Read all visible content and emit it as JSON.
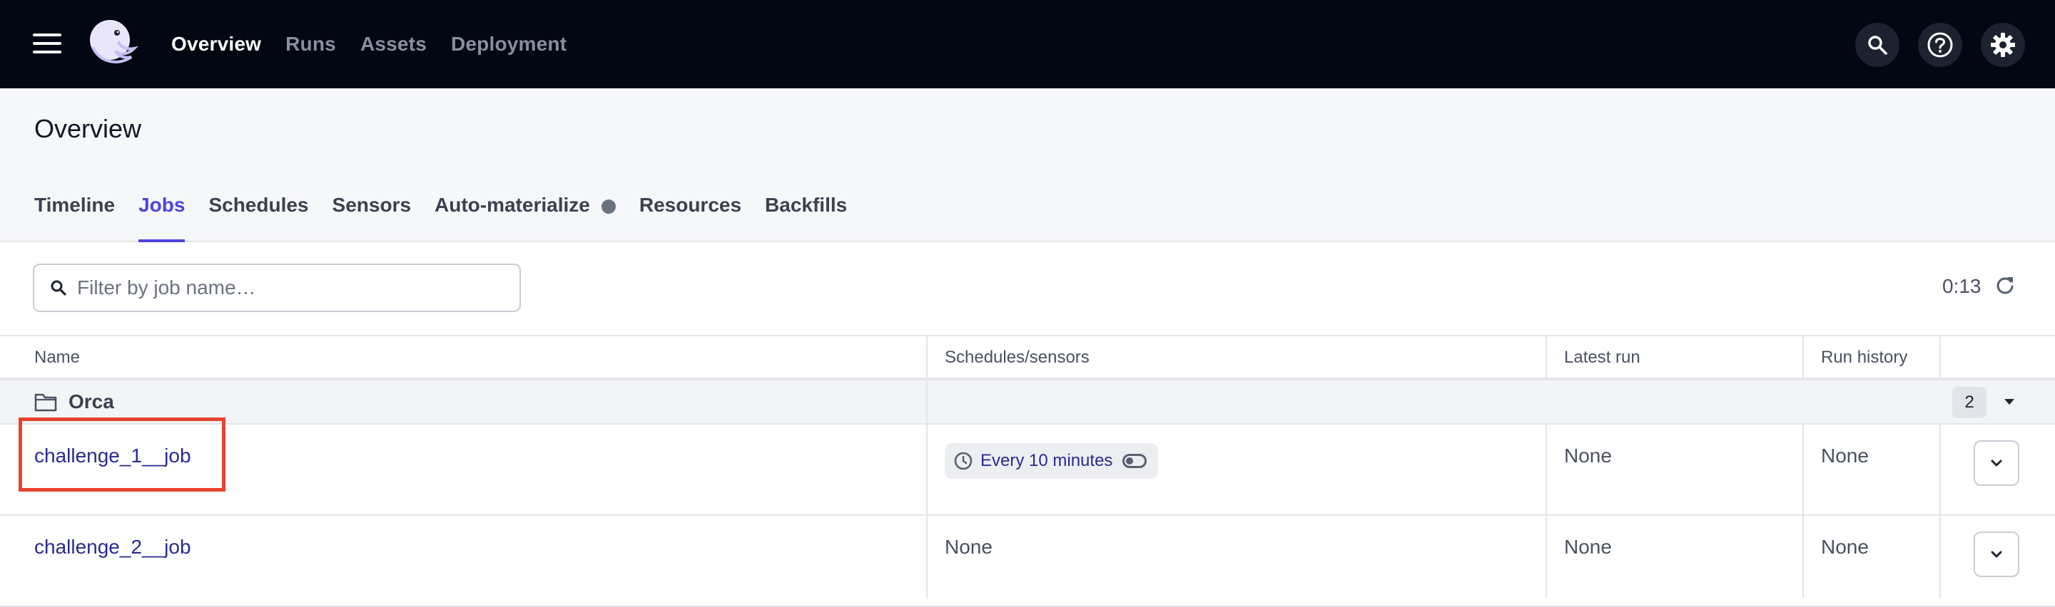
{
  "topnav": {
    "links": [
      "Overview",
      "Runs",
      "Assets",
      "Deployment"
    ],
    "active": "Overview",
    "icons": [
      "menu-icon",
      "dagster-logo",
      "search-icon",
      "help-icon",
      "settings-gear-icon"
    ]
  },
  "overview": {
    "title": "Overview",
    "tabs": [
      "Timeline",
      "Jobs",
      "Schedules",
      "Sensors",
      "Auto-materialize",
      "Resources",
      "Backfills"
    ],
    "active_tab": "Jobs"
  },
  "filter": {
    "placeholder": "Filter by job name…",
    "value": ""
  },
  "refresh": {
    "timer": "0:13"
  },
  "table": {
    "headers": [
      "Name",
      "Schedules/sensors",
      "Latest run",
      "Run history"
    ],
    "group": {
      "name": "Orca",
      "count": "2"
    },
    "rows": [
      {
        "name": "challenge_1__job",
        "schedule": "Every 10 minutes",
        "latest_run": "None",
        "run_history": "None",
        "highlighted": true
      },
      {
        "name": "challenge_2__job",
        "schedule": "None",
        "latest_run": "None",
        "run_history": "None",
        "highlighted": false
      }
    ]
  },
  "colors": {
    "nav_bg": "#030712",
    "accent": "#4f43dd",
    "link": "#2a2a8f",
    "highlight": "#e8432e"
  }
}
